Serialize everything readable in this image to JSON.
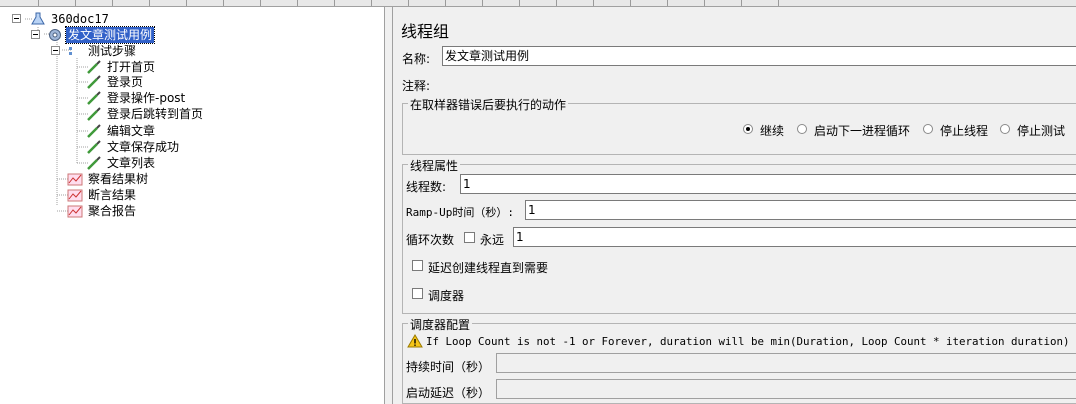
{
  "tree": {
    "root": "360doc17",
    "thread_group": "发文章测试用例",
    "controller": "测试步骤",
    "samplers": [
      "打开首页",
      "登录页",
      "登录操作-post",
      "登录后跳转到首页",
      "编辑文章",
      "文章保存成功",
      "文章列表"
    ],
    "listeners": [
      "察看结果树",
      "断言结果",
      "聚合报告"
    ]
  },
  "panel": {
    "title": "线程组",
    "name_label": "名称:",
    "name_value": "发文章测试用例",
    "comment_label": "注释:",
    "comment_value": "",
    "error_action": {
      "legend": "在取样器错误后要执行的动作",
      "options": [
        "继续",
        "启动下一进程循环",
        "停止线程",
        "停止测试"
      ],
      "selected": "继续"
    },
    "thread_props": {
      "legend": "线程属性",
      "threads_label": "线程数:",
      "threads_value": "1",
      "rampup_label": "Ramp-Up时间（秒）:",
      "rampup_value": "1",
      "loop_label": "循环次数",
      "forever_label": "永远",
      "forever_checked": false,
      "loop_value": "1",
      "delay_label": "延迟创建线程直到需要",
      "delay_checked": false,
      "scheduler_label": "调度器",
      "scheduler_checked": false
    },
    "scheduler_config": {
      "legend": "调度器配置",
      "warning": "If Loop Count is not -1 or Forever, duration will be min(Duration, Loop Count * iteration duration)",
      "duration_label": "持续时间（秒）",
      "duration_value": "",
      "startup_label": "启动延迟（秒）",
      "startup_value": ""
    }
  },
  "colors": {
    "selection": "#3161c9",
    "panel_bg": "#f0f0f0",
    "warning": "#f5c518"
  }
}
